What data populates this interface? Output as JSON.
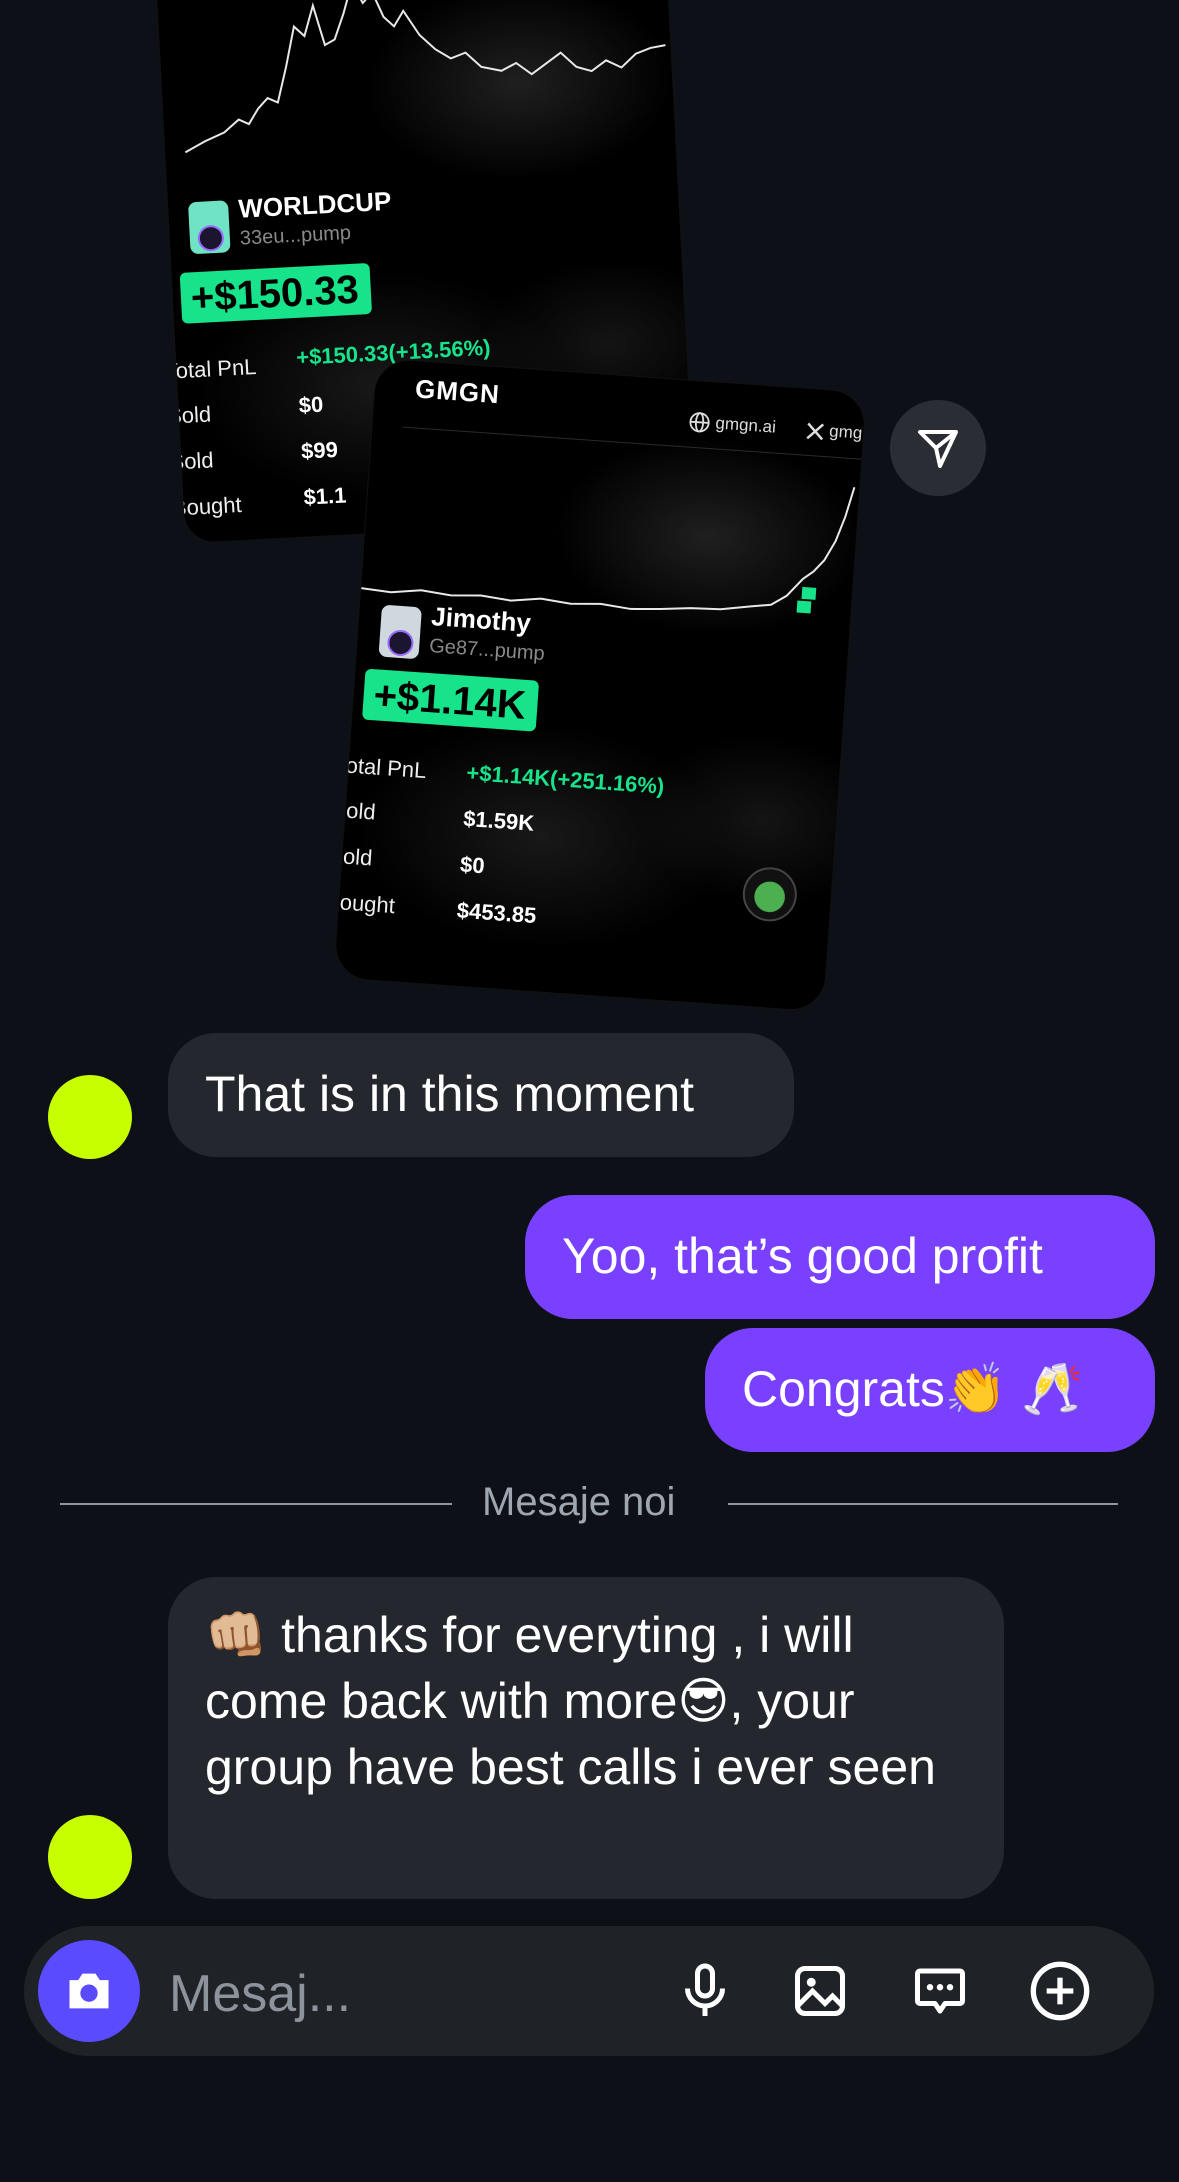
{
  "card1": {
    "token_name": "WORLDCUP",
    "token_address": "33eu...pump",
    "pnl_badge": "+$150.33",
    "rows": [
      {
        "label": "Total PnL",
        "value": "+$150.33(+13.56%)"
      },
      {
        "label": "Sold",
        "value": "$0"
      },
      {
        "label": "Sold",
        "value": "$99"
      },
      {
        "label": "Bought",
        "value": "$1.1"
      }
    ]
  },
  "card2": {
    "brand": "GMGN",
    "site": "gmgn.ai",
    "x_handle": "gmg",
    "token_name": "Jimothy",
    "token_address": "Ge87...pump",
    "pnl_badge": "+$1.14K",
    "rows": [
      {
        "label": "Total PnL",
        "value": "+$1.14K(+251.16%)"
      },
      {
        "label": "Sold",
        "value": "$1.59K"
      },
      {
        "label": "Sold",
        "value": "$0"
      },
      {
        "label": "Bought",
        "value": "$453.85"
      }
    ]
  },
  "messages": [
    {
      "side": "in",
      "text": "That is in this moment"
    },
    {
      "side": "out",
      "text": "Yoo, that’s good profit"
    },
    {
      "side": "out",
      "text": "Congrats👏 🥂"
    },
    {
      "side": "in",
      "text": "👊🏼 thanks for everyting , i will come back with more😎, your group have best calls i ever seen"
    }
  ],
  "divider": "Mesaje noi",
  "composer": {
    "placeholder": "Mesaj..."
  },
  "icons": [
    "share-icon",
    "camera-icon",
    "microphone-icon",
    "image-icon",
    "chat-bubble-icon",
    "plus-circle-icon"
  ],
  "colors": {
    "background": "#0d1117",
    "outgoing": "#7a40ff",
    "incoming": "#24272d",
    "avatar": "#c8ff00",
    "pnl_green": "#16e38a",
    "camera_button": "#5b4bff"
  }
}
